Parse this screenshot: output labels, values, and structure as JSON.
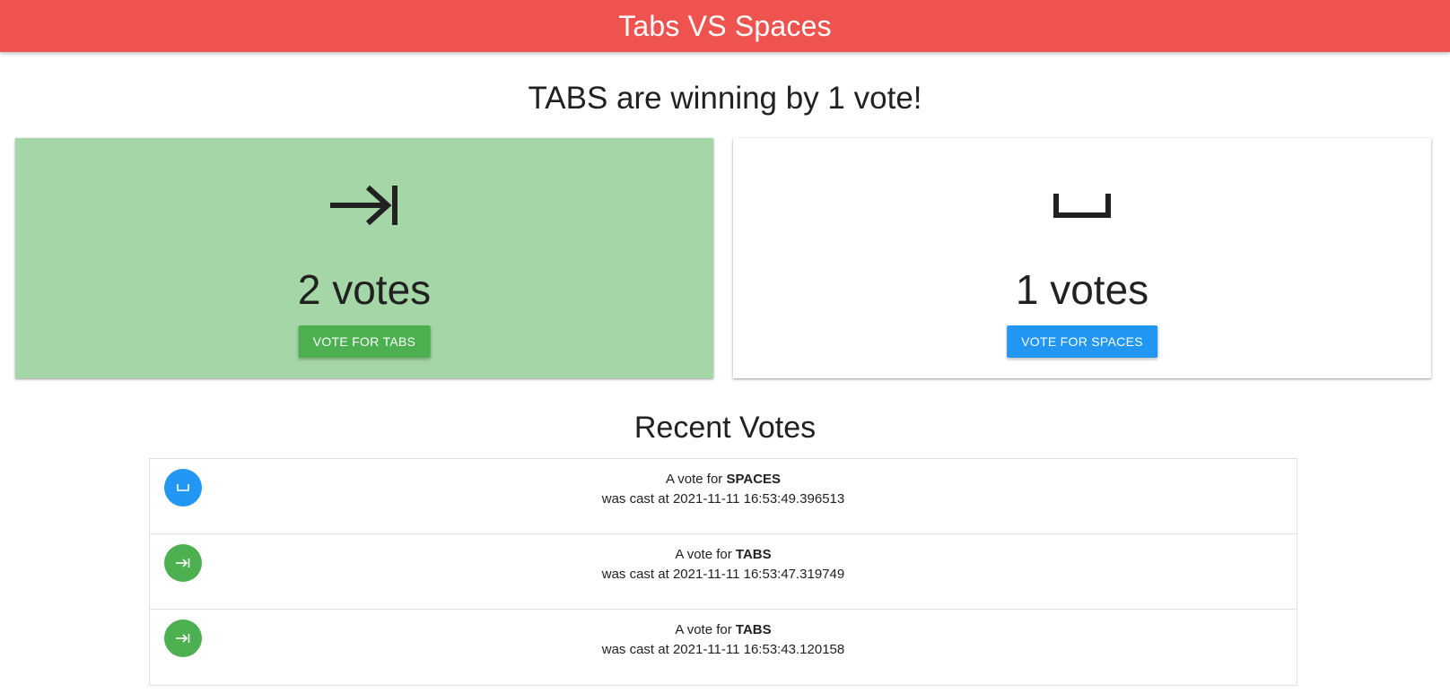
{
  "header": {
    "title": "Tabs VS Spaces"
  },
  "headline": "TABS are winning by 1 vote!",
  "cards": [
    {
      "id": "tabs",
      "icon": "tab-arrow-icon",
      "count_label": "2 votes",
      "button_label": "VOTE FOR TABS",
      "leading": true,
      "bg_color": "#a5d6a7",
      "button_color": "#4caf50"
    },
    {
      "id": "spaces",
      "icon": "space-icon",
      "count_label": "1 votes",
      "button_label": "VOTE FOR SPACES",
      "leading": false,
      "bg_color": "#ffffff",
      "button_color": "#2196f3"
    }
  ],
  "recent": {
    "title": "Recent Votes",
    "prefix": "A vote for",
    "cast_prefix": "was cast at",
    "items": [
      {
        "team": "SPACES",
        "icon": "space-icon",
        "color": "#2196f3",
        "timestamp": "2021-11-11 16:53:49.396513"
      },
      {
        "team": "TABS",
        "icon": "tab-arrow-icon",
        "color": "#4caf50",
        "timestamp": "2021-11-11 16:53:47.319749"
      },
      {
        "team": "TABS",
        "icon": "tab-arrow-icon",
        "color": "#4caf50",
        "timestamp": "2021-11-11 16:53:43.120158"
      }
    ]
  },
  "colors": {
    "header": "#ef5350",
    "tabs": "#4caf50",
    "spaces": "#2196f3",
    "tabs_card": "#a5d6a7"
  }
}
